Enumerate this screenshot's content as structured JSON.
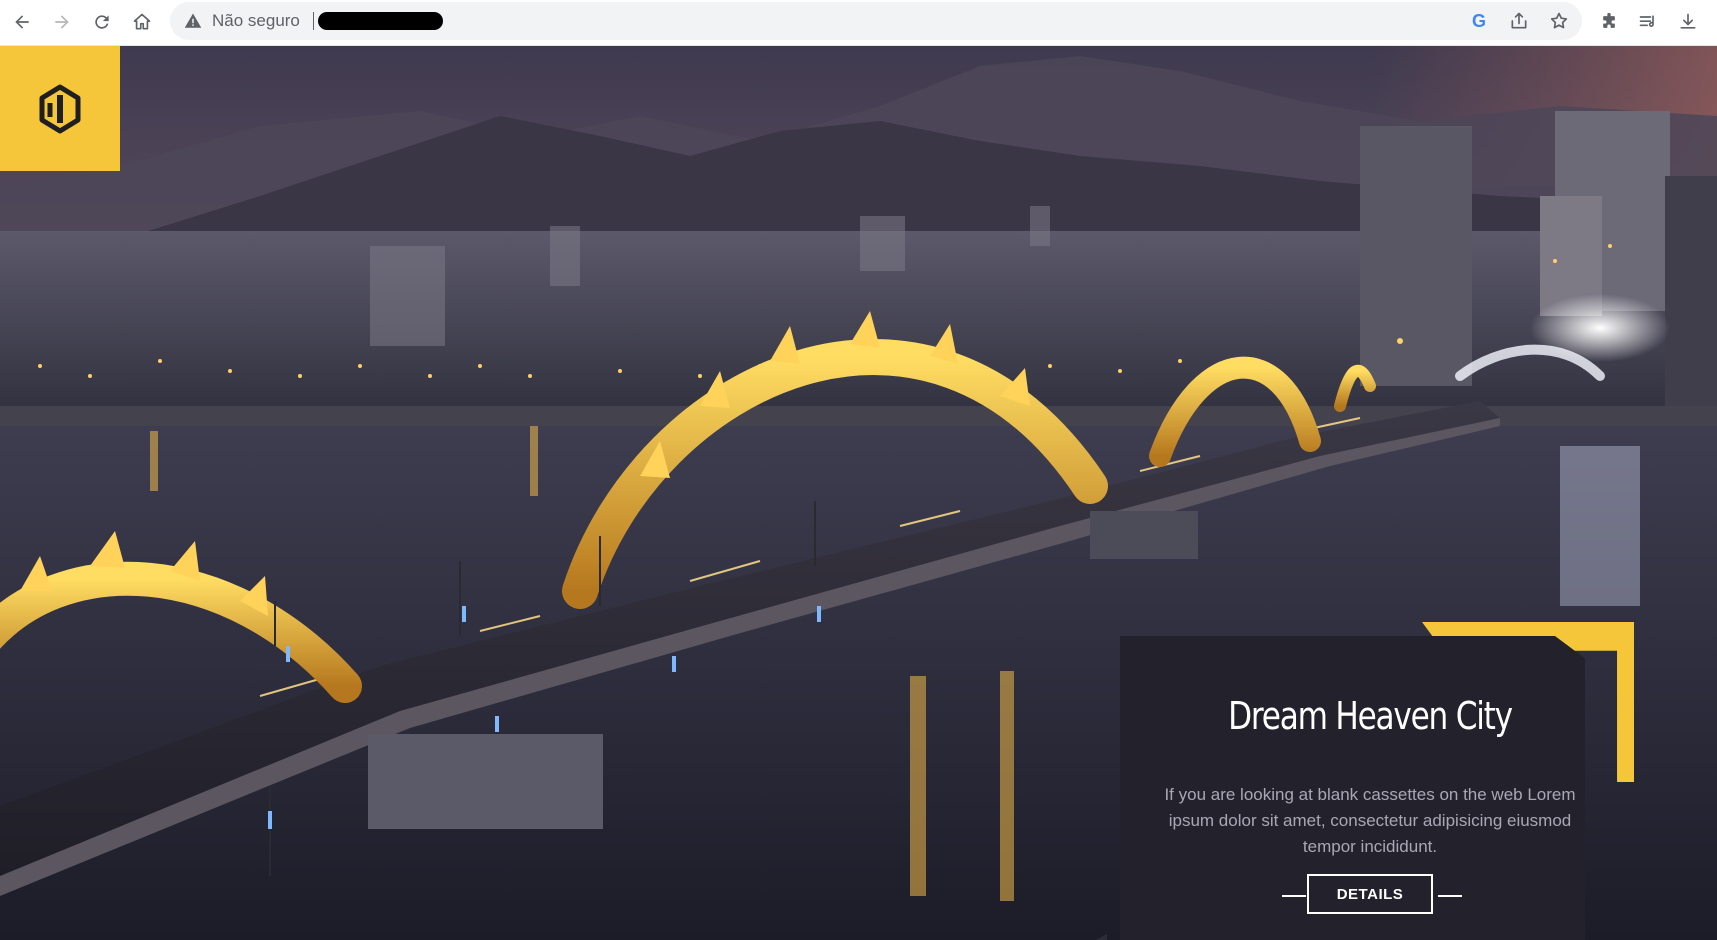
{
  "browser": {
    "security_label": "Não seguro",
    "url_redacted": true,
    "toolbar_icons": [
      "back-icon",
      "forward-icon",
      "reload-icon",
      "home-icon",
      "google-icon",
      "share-icon",
      "bookmark-star-icon",
      "extensions-icon",
      "reading-list-icon",
      "download-icon"
    ],
    "google_letter": "G"
  },
  "page": {
    "logo": {
      "icon": "logo-mark-icon",
      "color": "#f5c63a"
    },
    "hero": {
      "scene": "night-city-bridge",
      "accent_color": "#f5c63a"
    },
    "card": {
      "title": "Dream Heaven City",
      "text": "If you are looking at blank cassettes on the web Lorem ipsum dolor sit amet, consectetur adipisicing eiusmod tempor incididunt.",
      "button_label": "DETAILS",
      "background": "#23222c"
    }
  }
}
